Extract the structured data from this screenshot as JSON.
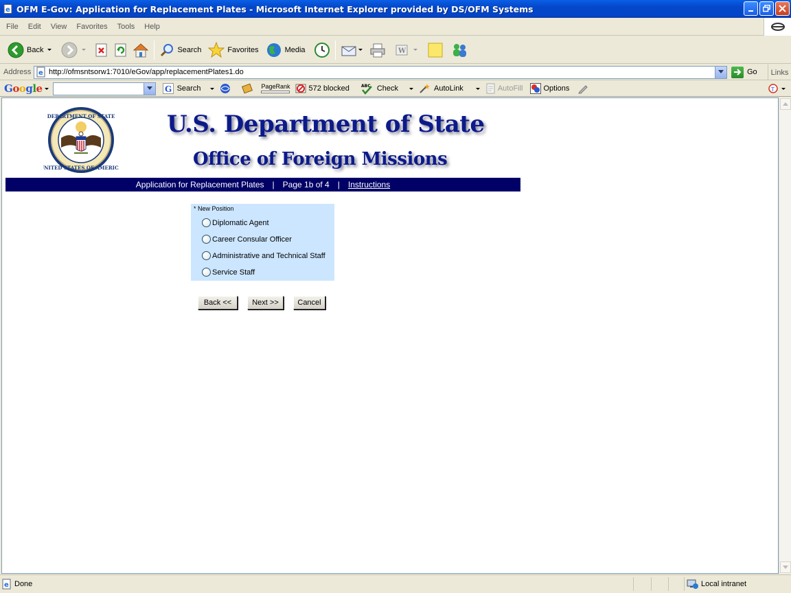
{
  "window": {
    "title": "OFM E-Gov: Application for Replacement Plates - Microsoft Internet Explorer provided by DS/OFM Systems"
  },
  "menu": [
    "File",
    "Edit",
    "View",
    "Favorites",
    "Tools",
    "Help"
  ],
  "toolbar": {
    "back": "Back",
    "search": "Search",
    "favorites": "Favorites",
    "media": "Media"
  },
  "address": {
    "label": "Address",
    "url": "http://ofmsntsorw1:7010/eGov/app/replacementPlates1.do",
    "go": "Go",
    "links": "Links"
  },
  "google_toolbar": {
    "logo": "Google",
    "search": "Search",
    "pagerank": "PageRank",
    "blocked": "572 blocked",
    "check": "Check",
    "autolink": "AutoLink",
    "autofill": "AutoFill",
    "options": "Options"
  },
  "page": {
    "heading": "U.S. Department of State",
    "subheading": "Office of Foreign Missions",
    "nav": {
      "title": "Application for Replacement Plates",
      "page": "Page 1b of 4",
      "instructions": "Instructions",
      "separator": "|"
    },
    "form": {
      "label": "* New Position",
      "options": [
        "Diplomatic Agent",
        "Career Consular Officer",
        "Administrative and Technical Staff",
        "Service Staff"
      ]
    },
    "buttons": {
      "back": "Back <<",
      "next": "Next >>",
      "cancel": "Cancel"
    }
  },
  "status": {
    "text": "Done",
    "zone": "Local intranet"
  },
  "colors": {
    "titlebar": "#0447c8",
    "nav_band": "#000066",
    "heading": "#0c1a8a",
    "form_bg": "#cce6ff"
  }
}
